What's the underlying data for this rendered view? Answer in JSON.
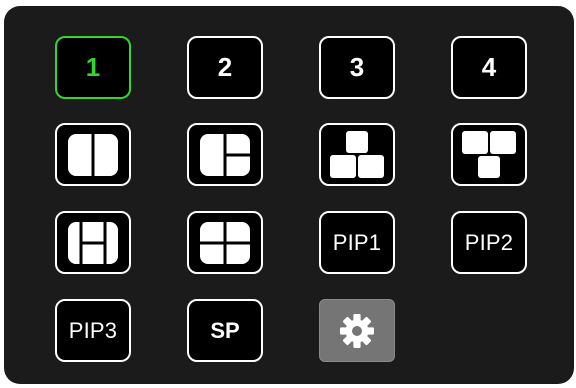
{
  "camera_buttons": [
    {
      "label": "1",
      "active": true
    },
    {
      "label": "2",
      "active": false
    },
    {
      "label": "3",
      "active": false
    },
    {
      "label": "4",
      "active": false
    }
  ],
  "layout_buttons": [
    {
      "icon": "split-2-vertical-icon"
    },
    {
      "icon": "split-3-left-large-icon"
    },
    {
      "icon": "split-3-top-one-bottom-two-icon"
    },
    {
      "icon": "split-3-top-two-bottom-one-icon"
    },
    {
      "icon": "split-3-center-large-icon"
    },
    {
      "icon": "split-4-quad-icon"
    }
  ],
  "pip_buttons": [
    "PIP1",
    "PIP2",
    "PIP3"
  ],
  "sp_label": "SP",
  "settings_icon": "gear-icon",
  "colors": {
    "panel": "#1b1b1b",
    "button_bg": "#000000",
    "button_border": "#ffffff",
    "active": "#35d62c",
    "settings_bg": "#757575"
  }
}
